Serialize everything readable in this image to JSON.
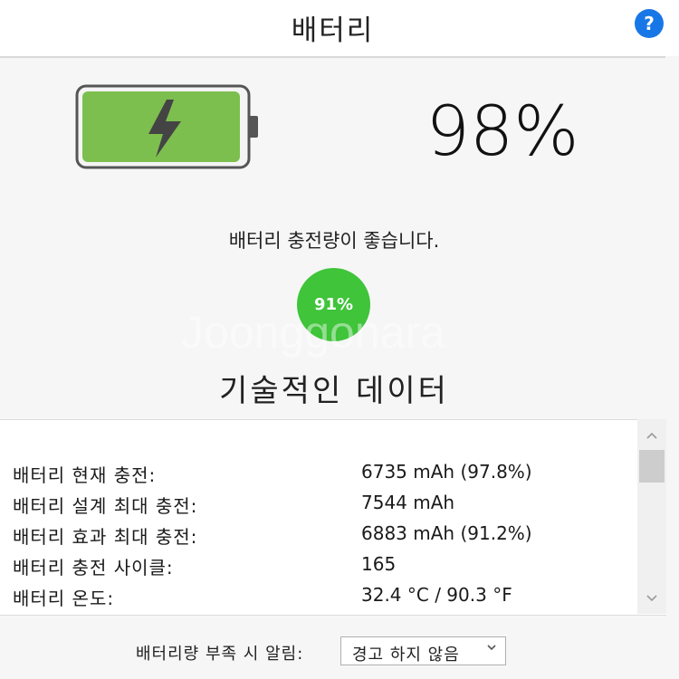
{
  "header": {
    "title": "배터리",
    "help_label": "?"
  },
  "battery": {
    "percent_text": "98%",
    "charge_level": 0.98,
    "status_text": "배터리 충전량이 좋습니다.",
    "health_text": "91%",
    "fill_color": "#7dbf4e",
    "health_color": "#3fc43a"
  },
  "watermark": "Joonggonara",
  "technical": {
    "title": "기술적인 데이터",
    "rows": [
      {
        "label": "배터리 현재 충전:",
        "value": "6735 mAh (97.8%)"
      },
      {
        "label": "배터리 설계 최대 충전:",
        "value": "7544 mAh"
      },
      {
        "label": "배터리 효과 최대 충전:",
        "value": "6883 mAh (91.2%)"
      },
      {
        "label": "배터리 충전 사이클:",
        "value": "165"
      },
      {
        "label": "배터리 온도:",
        "value": "32.4 °C / 90.3 °F"
      }
    ]
  },
  "scrollbar": {
    "up_icon": "chevron-up-icon",
    "down_icon": "chevron-down-icon"
  },
  "footer": {
    "alert_label": "배터리량 부족 시 알림:",
    "alert_value": "경고 하지 않음"
  },
  "colors": {
    "accent": "#1877e6"
  }
}
